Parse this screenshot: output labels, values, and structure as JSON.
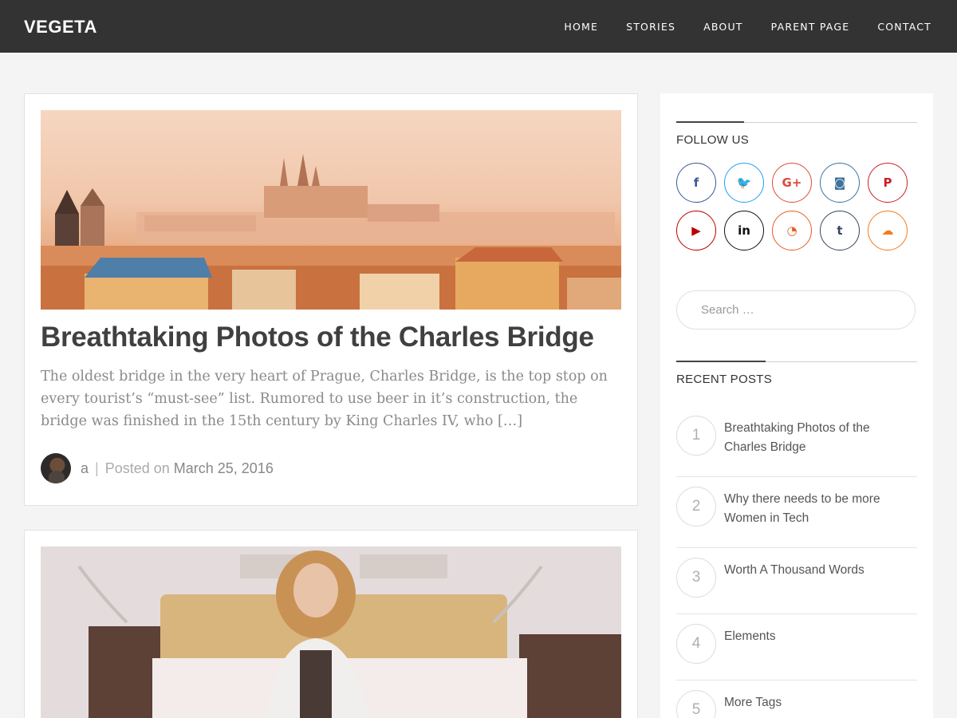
{
  "site": {
    "brand": "VEGETA"
  },
  "nav": [
    "HOME",
    "STORIES",
    "ABOUT",
    "PARENT PAGE",
    "CONTACT"
  ],
  "posts": [
    {
      "title": "Breathtaking Photos of the Charles Bridge",
      "excerpt": "The oldest bridge in the very heart of Prague, Charles Bridge, is the top stop on every tourist’s “must-see” list. Rumored to use beer in it’s construction, the bridge was finished in the 15th century by King Charles IV, who […]",
      "author": "a",
      "posted_label": "Posted on",
      "date": "March 25, 2016"
    }
  ],
  "sidebar": {
    "follow_title": "FOLLOW US",
    "social": [
      {
        "icon": "facebook-icon",
        "glyph": "f",
        "color": "#3b5998"
      },
      {
        "icon": "twitter-icon",
        "glyph": "🐦",
        "color": "#1da1f2"
      },
      {
        "icon": "google-plus-icon",
        "glyph": "G+",
        "color": "#dd4b39"
      },
      {
        "icon": "instagram-icon",
        "glyph": "◙",
        "color": "#3f729b"
      },
      {
        "icon": "pinterest-icon",
        "glyph": "P",
        "color": "#cb2027"
      },
      {
        "icon": "youtube-icon",
        "glyph": "▶",
        "color": "#bb0000"
      },
      {
        "icon": "linkedin-icon",
        "glyph": "in",
        "color": "#111111"
      },
      {
        "icon": "rss-icon",
        "glyph": "◔",
        "color": "#e95d22"
      },
      {
        "icon": "tumblr-icon",
        "glyph": "t",
        "color": "#35465c"
      },
      {
        "icon": "soundcloud-icon",
        "glyph": "☁",
        "color": "#f57a1a"
      }
    ],
    "search_placeholder": "Search …",
    "recent_title": "RECENT POSTS",
    "recent": [
      {
        "num": "1",
        "title": "Breathtaking Photos of the Charles Bridge"
      },
      {
        "num": "2",
        "title": "Why there needs to be more Women in Tech"
      },
      {
        "num": "3",
        "title": "Worth A Thousand Words"
      },
      {
        "num": "4",
        "title": "Elements"
      },
      {
        "num": "5",
        "title": "More Tags"
      }
    ]
  }
}
